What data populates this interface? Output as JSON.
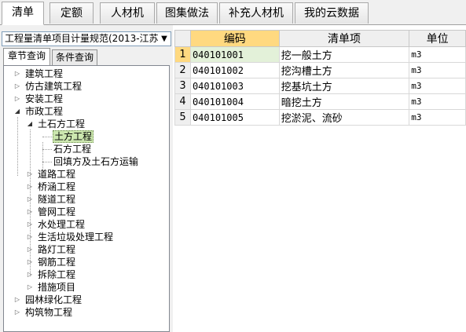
{
  "tabs": [
    "清单",
    "定额",
    "人材机",
    "图集做法",
    "补充人材机",
    "我的云数据"
  ],
  "left": {
    "norm_select": "工程量清单项目计量规范(2013-江苏",
    "subtabs": [
      "章节查询",
      "条件查询"
    ],
    "tree": [
      {
        "label": "建筑工程"
      },
      {
        "label": "仿古建筑工程"
      },
      {
        "label": "安装工程"
      },
      {
        "label": "市政工程"
      },
      {
        "label": "土石方工程"
      },
      {
        "label": "土方工程"
      },
      {
        "label": "石方工程"
      },
      {
        "label": "回填方及土石方运输"
      },
      {
        "label": "道路工程"
      },
      {
        "label": "桥涵工程"
      },
      {
        "label": "隧道工程"
      },
      {
        "label": "管网工程"
      },
      {
        "label": "水处理工程"
      },
      {
        "label": "生活垃圾处理工程"
      },
      {
        "label": "路灯工程"
      },
      {
        "label": "钢筋工程"
      },
      {
        "label": "拆除工程"
      },
      {
        "label": "措施项目"
      },
      {
        "label": "园林绿化工程"
      },
      {
        "label": "构筑物工程"
      }
    ]
  },
  "grid": {
    "headers": {
      "code": "编码",
      "name": "清单项",
      "unit": "单位"
    },
    "rows": [
      {
        "no": "1",
        "code": "040101001",
        "name": "挖一般土方",
        "unit": "m3"
      },
      {
        "no": "2",
        "code": "040101002",
        "name": "挖沟槽土方",
        "unit": "m3"
      },
      {
        "no": "3",
        "code": "040101003",
        "name": "挖基坑土方",
        "unit": "m3"
      },
      {
        "no": "4",
        "code": "040101004",
        "name": "暗挖土方",
        "unit": "m3"
      },
      {
        "no": "5",
        "code": "040101005",
        "name": "挖淤泥、流砂",
        "unit": "m3"
      }
    ]
  }
}
